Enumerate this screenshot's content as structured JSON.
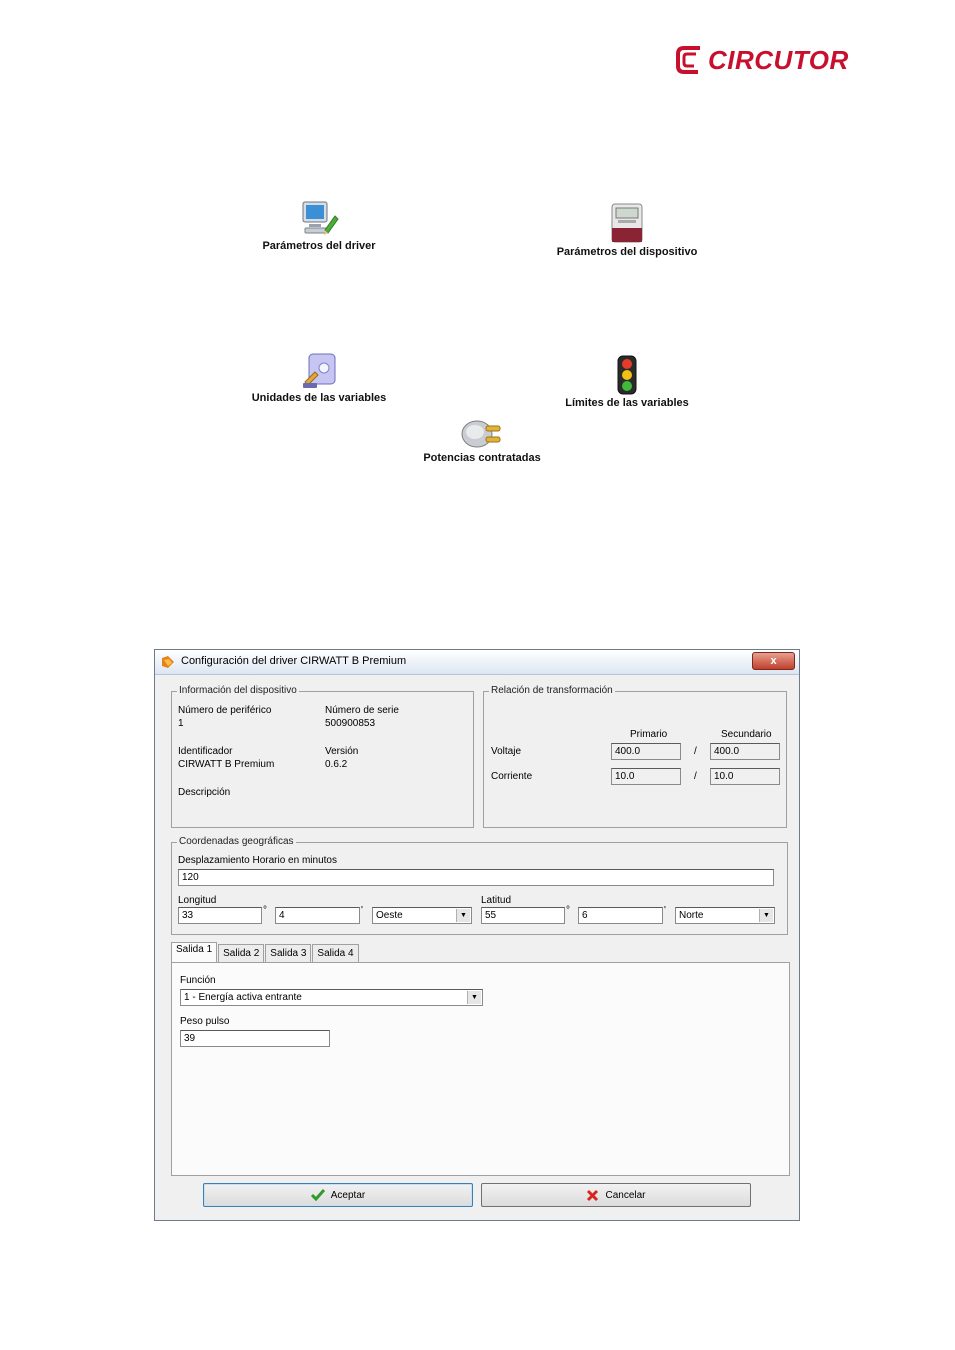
{
  "brand": {
    "logo_text": "CIRCUTOR",
    "color": "#c8102e"
  },
  "launchers": {
    "driver_params": {
      "label": "Parámetros del driver",
      "icon": "monitor-pencil-icon"
    },
    "device_params": {
      "label": "Parámetros del dispositivo",
      "icon": "meter-device-icon"
    },
    "units": {
      "label": "Unidades de las variables",
      "icon": "units-document-icon"
    },
    "limits": {
      "label": "Límites de las variables",
      "icon": "traffic-light-icon"
    },
    "power": {
      "label": "Potencias contratadas",
      "icon": "plug-icon"
    }
  },
  "dialog": {
    "title": "Configuración del driver CIRWATT B Premium",
    "close_label": "x",
    "device_info": {
      "title": "Información del dispositivo",
      "peripheral_label": "Número de periférico",
      "peripheral_value": "1",
      "serial_label": "Número de serie",
      "serial_value": "500900853",
      "identifier_label": "Identificador",
      "identifier_value": "CIRWATT B Premium",
      "version_label": "Versión",
      "version_value": "0.6.2",
      "description_label": "Descripción"
    },
    "transformation": {
      "title": "Relación de transformación",
      "primary_header": "Primario",
      "secondary_header": "Secundario",
      "voltage_label": "Voltaje",
      "voltage_primary": "400.0",
      "voltage_secondary": "400.0",
      "current_label": "Corriente",
      "current_primary": "10.0",
      "current_secondary": "10.0",
      "separator": "/"
    },
    "geo": {
      "title": "Coordenadas geográficas",
      "offset_label": "Desplazamiento Horario en minutos",
      "offset_value": "120",
      "longitude_label": "Longitud",
      "longitude_deg": "33",
      "longitude_min": "4",
      "longitude_dir": "Oeste",
      "latitude_label": "Latitud",
      "latitude_deg": "55",
      "latitude_min": "6",
      "latitude_dir": "Norte",
      "degree_symbol": "°",
      "minute_symbol": "'"
    },
    "tabs": [
      "Salida 1",
      "Salida 2",
      "Salida 3",
      "Salida 4"
    ],
    "output": {
      "function_label": "Función",
      "function_value": "1 - Energía activa entrante",
      "pulse_label": "Peso pulso",
      "pulse_value": "39"
    },
    "buttons": {
      "accept": "Aceptar",
      "cancel": "Cancelar"
    }
  }
}
